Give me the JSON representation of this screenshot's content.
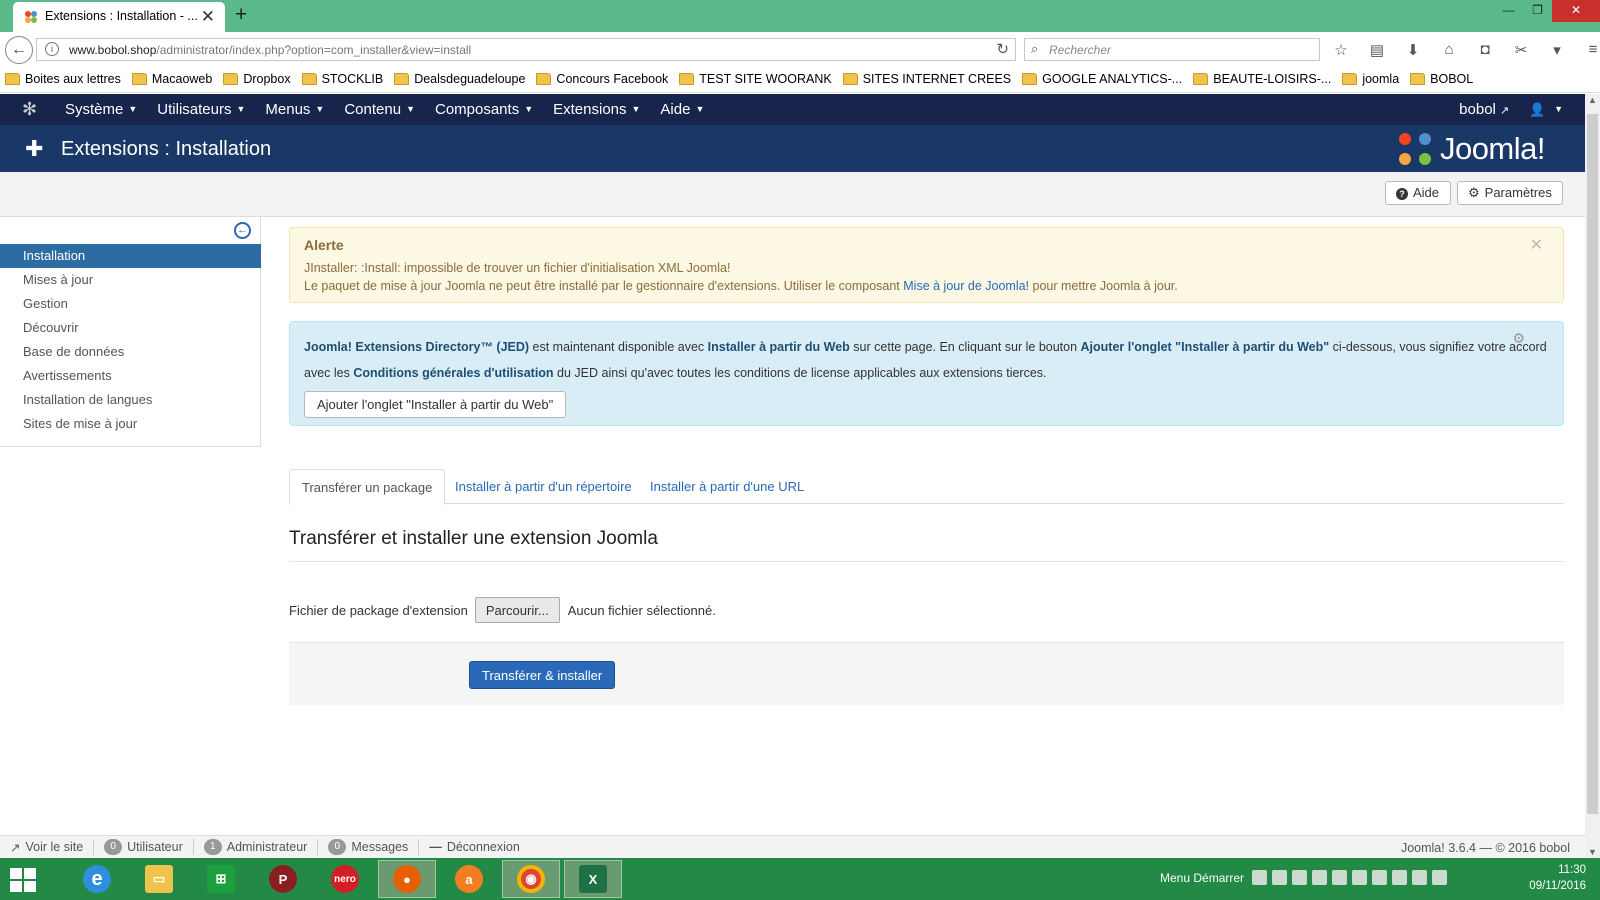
{
  "browser": {
    "tab_title": "Extensions : Installation - ...",
    "url_host": "www.bobol.shop",
    "url_path": "/administrator/index.php?option=com_installer&view=install",
    "search_placeholder": "Rechercher",
    "bookmarks": [
      {
        "label": "Boites aux lettres",
        "folder": true
      },
      {
        "label": "Macaoweb",
        "folder": true
      },
      {
        "label": "Dropbox",
        "folder": true
      },
      {
        "label": "STOCKLIB",
        "folder": true
      },
      {
        "label": "Dealsdeguadeloupe",
        "folder": true
      },
      {
        "label": "Concours Facebook",
        "folder": true
      },
      {
        "label": "TEST SITE WOORANK",
        "folder": true
      },
      {
        "label": "SITES INTERNET CREES",
        "folder": true
      },
      {
        "label": "GOOGLE ANALYTICS-...",
        "folder": true
      },
      {
        "label": "BEAUTE-LOISIRS-...",
        "folder": true
      },
      {
        "label": "joomla",
        "folder": true
      },
      {
        "label": "BOBOL",
        "folder": true
      }
    ]
  },
  "joomla": {
    "menu": [
      "Système",
      "Utilisateurs",
      "Menus",
      "Contenu",
      "Composants",
      "Extensions",
      "Aide"
    ],
    "site_name": "bobol",
    "page_title": "Extensions : Installation",
    "brand": "Joomla!",
    "toolbar": {
      "help": "Aide",
      "options": "Paramètres"
    },
    "sidebar": [
      {
        "label": "Installation",
        "active": true
      },
      {
        "label": "Mises à jour",
        "active": false
      },
      {
        "label": "Gestion",
        "active": false
      },
      {
        "label": "Découvrir",
        "active": false
      },
      {
        "label": "Base de données",
        "active": false
      },
      {
        "label": "Avertissements",
        "active": false
      },
      {
        "label": "Installation de langues",
        "active": false
      },
      {
        "label": "Sites de mise à jour",
        "active": false
      }
    ],
    "alert": {
      "heading": "Alerte",
      "line1": "JInstaller: :Install: impossible de trouver un fichier d'initialisation XML Joomla!",
      "line2_before": "Le paquet de mise à jour Joomla ne peut être installé par le gestionnaire d'extensions. Utiliser le composant ",
      "line2_link": "Mise à jour de Joomla!",
      "line2_after": " pour mettre Joomla à jour."
    },
    "jed": {
      "p1": "Joomla! Extensions Directory™ (JED)",
      "p2": " est maintenant disponible avec ",
      "p3": "Installer à partir du Web",
      "p4": " sur cette page. En cliquant sur le bouton ",
      "p5": "Ajouter l'onglet \"Installer à partir du Web\"",
      "p6": " ci-dessous, vous signifiez votre accord avec les ",
      "p7": "Conditions générales d'utilisation",
      "p8": " du JED ainsi qu'avec toutes les conditions de license applicables aux extensions tierces.",
      "button": "Ajouter l'onglet \"Installer à partir du Web\""
    },
    "tabs": [
      "Transférer un package",
      "Installer à partir d'un répertoire",
      "Installer à partir d'une URL"
    ],
    "upload": {
      "title": "Transférer et installer une extension Joomla",
      "file_label": "Fichier de package d'extension",
      "browse": "Parcourir...",
      "no_file": "Aucun fichier sélectionné.",
      "submit": "Transférer & installer"
    },
    "status": {
      "view_site": "Voir le site",
      "users_count": "0",
      "users_label": "Utilisateur",
      "admins_count": "1",
      "admins_label": "Administrateur",
      "messages_count": "0",
      "messages_label": "Messages",
      "logout": "Déconnexion",
      "version": "Joomla! 3.6.4 — © 2016 bobol"
    }
  },
  "taskbar": {
    "tray_label": "Menu Démarrer",
    "time": "11:30",
    "date": "09/11/2016"
  },
  "colors": {
    "joomla_nav": "#17244c",
    "joomla_header": "#1a3867",
    "accent": "#2a69b8",
    "taskbar": "#228a46",
    "tabbar": "#5cb98c"
  }
}
